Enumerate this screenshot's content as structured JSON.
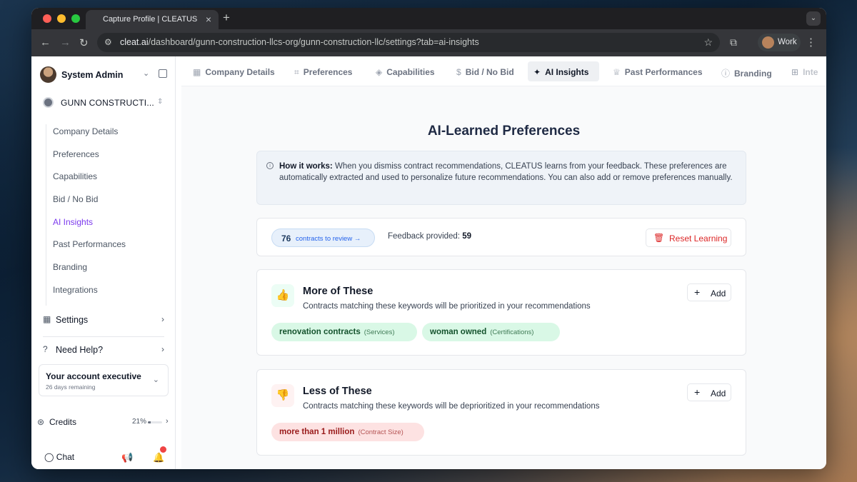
{
  "browser": {
    "tab_title": "Capture Profile | CLEATUS",
    "url_domain": "cleat.ai",
    "url_path": "/dashboard/gunn-construction-llcs-org/gunn-construction-llc/settings?tab=ai-insights",
    "profile_label": "Work"
  },
  "sidebar": {
    "user_name": "System Admin",
    "org_name": "GUNN CONSTRUCTI...",
    "items": [
      {
        "label": "Company Details"
      },
      {
        "label": "Preferences"
      },
      {
        "label": "Capabilities"
      },
      {
        "label": "Bid / No Bid"
      },
      {
        "label": "AI Insights",
        "active": true
      },
      {
        "label": "Past Performances"
      },
      {
        "label": "Branding"
      },
      {
        "label": "Integrations"
      }
    ],
    "settings_label": "Settings",
    "help_label": "Need Help?",
    "exec_title": "Your account executive",
    "exec_sub": "26 days remaining",
    "credits_label": "Credits",
    "credits_pct": "21%",
    "credits_fraction": 0.21,
    "chat_label": "Chat"
  },
  "tabs": [
    {
      "label": "Company Details",
      "icon": "building-icon"
    },
    {
      "label": "Preferences",
      "icon": "tag-icon"
    },
    {
      "label": "Capabilities",
      "icon": "layers-icon"
    },
    {
      "label": "Bid / No Bid",
      "icon": "dollar-icon"
    },
    {
      "label": "AI Insights",
      "icon": "sparkles-icon",
      "active": true
    },
    {
      "label": "Past Performances",
      "icon": "award-icon"
    },
    {
      "label": "Branding",
      "icon": "info-icon"
    },
    {
      "label": "Inte",
      "icon": "grid-icon"
    }
  ],
  "main": {
    "title": "AI-Learned Preferences",
    "info_bold": "How it works:",
    "info_text": " When you dismiss contract recommendations, CLEATUS learns from your feedback. These preferences are automatically extracted and used to personalize future recommendations. You can also add or remove preferences manually.",
    "review_count": "76",
    "review_text": "contracts to review →",
    "feedback_label": "Feedback provided: ",
    "feedback_count": "59",
    "reset_label": "Reset Learning"
  },
  "more": {
    "title": "More of These",
    "desc": "Contracts matching these keywords will be prioritized in your recommendations",
    "add_label": "Add",
    "chips": [
      {
        "keyword": "renovation contracts",
        "category": "(Services)"
      },
      {
        "keyword": "woman owned",
        "category": "(Certifications)"
      }
    ]
  },
  "less": {
    "title": "Less of These",
    "desc": "Contracts matching these keywords will be deprioritized in your recommendations",
    "add_label": "Add",
    "chips": [
      {
        "keyword": "more than 1 million",
        "category": "(Contract Size)"
      }
    ]
  },
  "colors": {
    "accent": "#7c3aed",
    "positive": "#16a34a",
    "negative": "#dc2626"
  }
}
